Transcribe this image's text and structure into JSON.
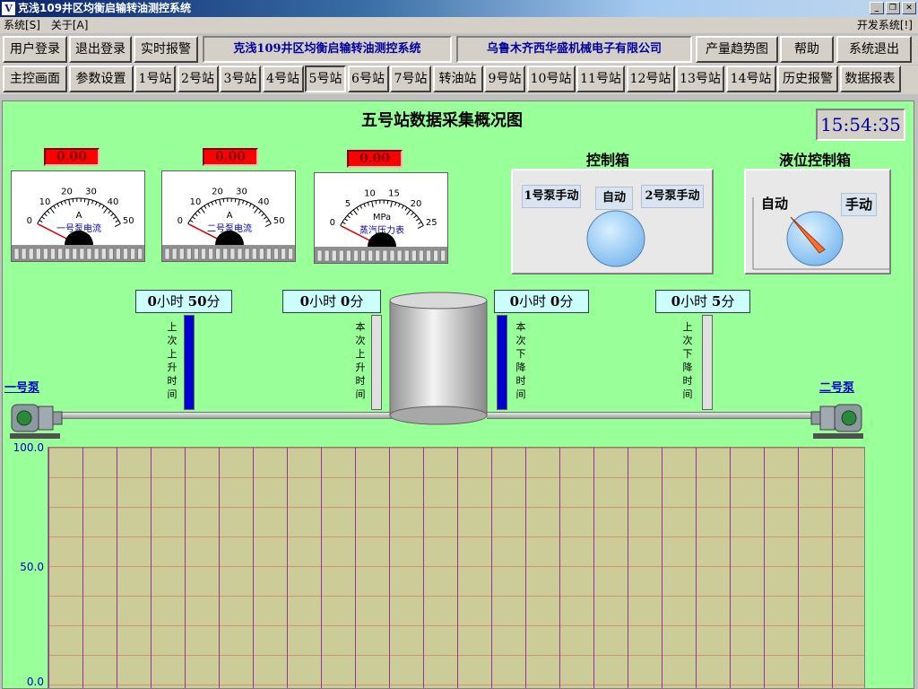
{
  "window": {
    "title": "克浅109井区均衡启输转油测控系统"
  },
  "menu": {
    "system": "系统[S]",
    "about": "关于[A]",
    "dev": "开发系统[!]"
  },
  "toolbar1": {
    "login": "用户登录",
    "logout": "退出登录",
    "alarm": "实时报警",
    "banner_system": "克浅109井区均衡启输转油测控系统",
    "banner_company": "乌鲁木齐西华盛机械电子有限公司",
    "trend": "产量趋势图",
    "help": "帮助",
    "exit": "系统退出"
  },
  "toolbar2": {
    "items": [
      "主控画面",
      "参数设置",
      "1号站",
      "2号站",
      "3号站",
      "4号站",
      "5号站",
      "6号站",
      "7号站",
      "转油站",
      "9号站",
      "10号站",
      "11号站",
      "12号站",
      "13号站",
      "14号站",
      "历史报警",
      "数据报表"
    ],
    "selected": "5号站"
  },
  "main": {
    "title": "五号站数据采集概况图",
    "clock": "15:54:35",
    "gauges": [
      {
        "reading": "0.00",
        "unit": "A",
        "name": "一号泵电流",
        "ticks": [
          "0",
          "10",
          "20",
          "30",
          "40",
          "50"
        ],
        "value": 0
      },
      {
        "reading": "0.00",
        "unit": "A",
        "name": "二号泵电流",
        "ticks": [
          "0",
          "10",
          "20",
          "30",
          "40",
          "50"
        ],
        "value": 0
      },
      {
        "reading": "0.00",
        "unit": "MPa",
        "name": "蒸汽压力表",
        "ticks": [
          "0",
          "5",
          "10",
          "15",
          "20",
          "25"
        ],
        "value": 0
      }
    ],
    "control_box": {
      "title": "控制箱",
      "pump1": "1号泵手动",
      "auto": "自动",
      "pump2": "2号泵手动"
    },
    "level_box": {
      "title": "液位控制箱",
      "auto": "自动",
      "manual": "手动"
    },
    "timers": [
      {
        "hours": "0",
        "hour_unit": "小时",
        "minutes": "50",
        "minute_unit": "分",
        "label": "上次上升时间",
        "level": 1.0
      },
      {
        "hours": "0",
        "hour_unit": "小时",
        "minutes": "0",
        "minute_unit": "分",
        "label": "本次上升时间",
        "level": 0.0
      },
      {
        "hours": "0",
        "hour_unit": "小时",
        "minutes": "0",
        "minute_unit": "分",
        "label": "本次下降时间",
        "level": 1.0
      },
      {
        "hours": "0",
        "hour_unit": "小时",
        "minutes": "5",
        "minute_unit": "分",
        "label": "上次下降时间",
        "level": 0.0
      }
    ],
    "pump_left": "一号泵",
    "pump_right": "二号泵",
    "chart": {
      "y_ticks": [
        "100.0",
        "50.0",
        "0.0"
      ]
    }
  },
  "colors": {
    "panel": "#99ff99",
    "grid": "#cccc99",
    "reading": "#ff0000",
    "level_fill": "#0000d0"
  },
  "icons": {
    "app": "app-logo-icon",
    "minimize": "minimize-icon",
    "restore": "restore-icon",
    "close": "close-icon"
  }
}
